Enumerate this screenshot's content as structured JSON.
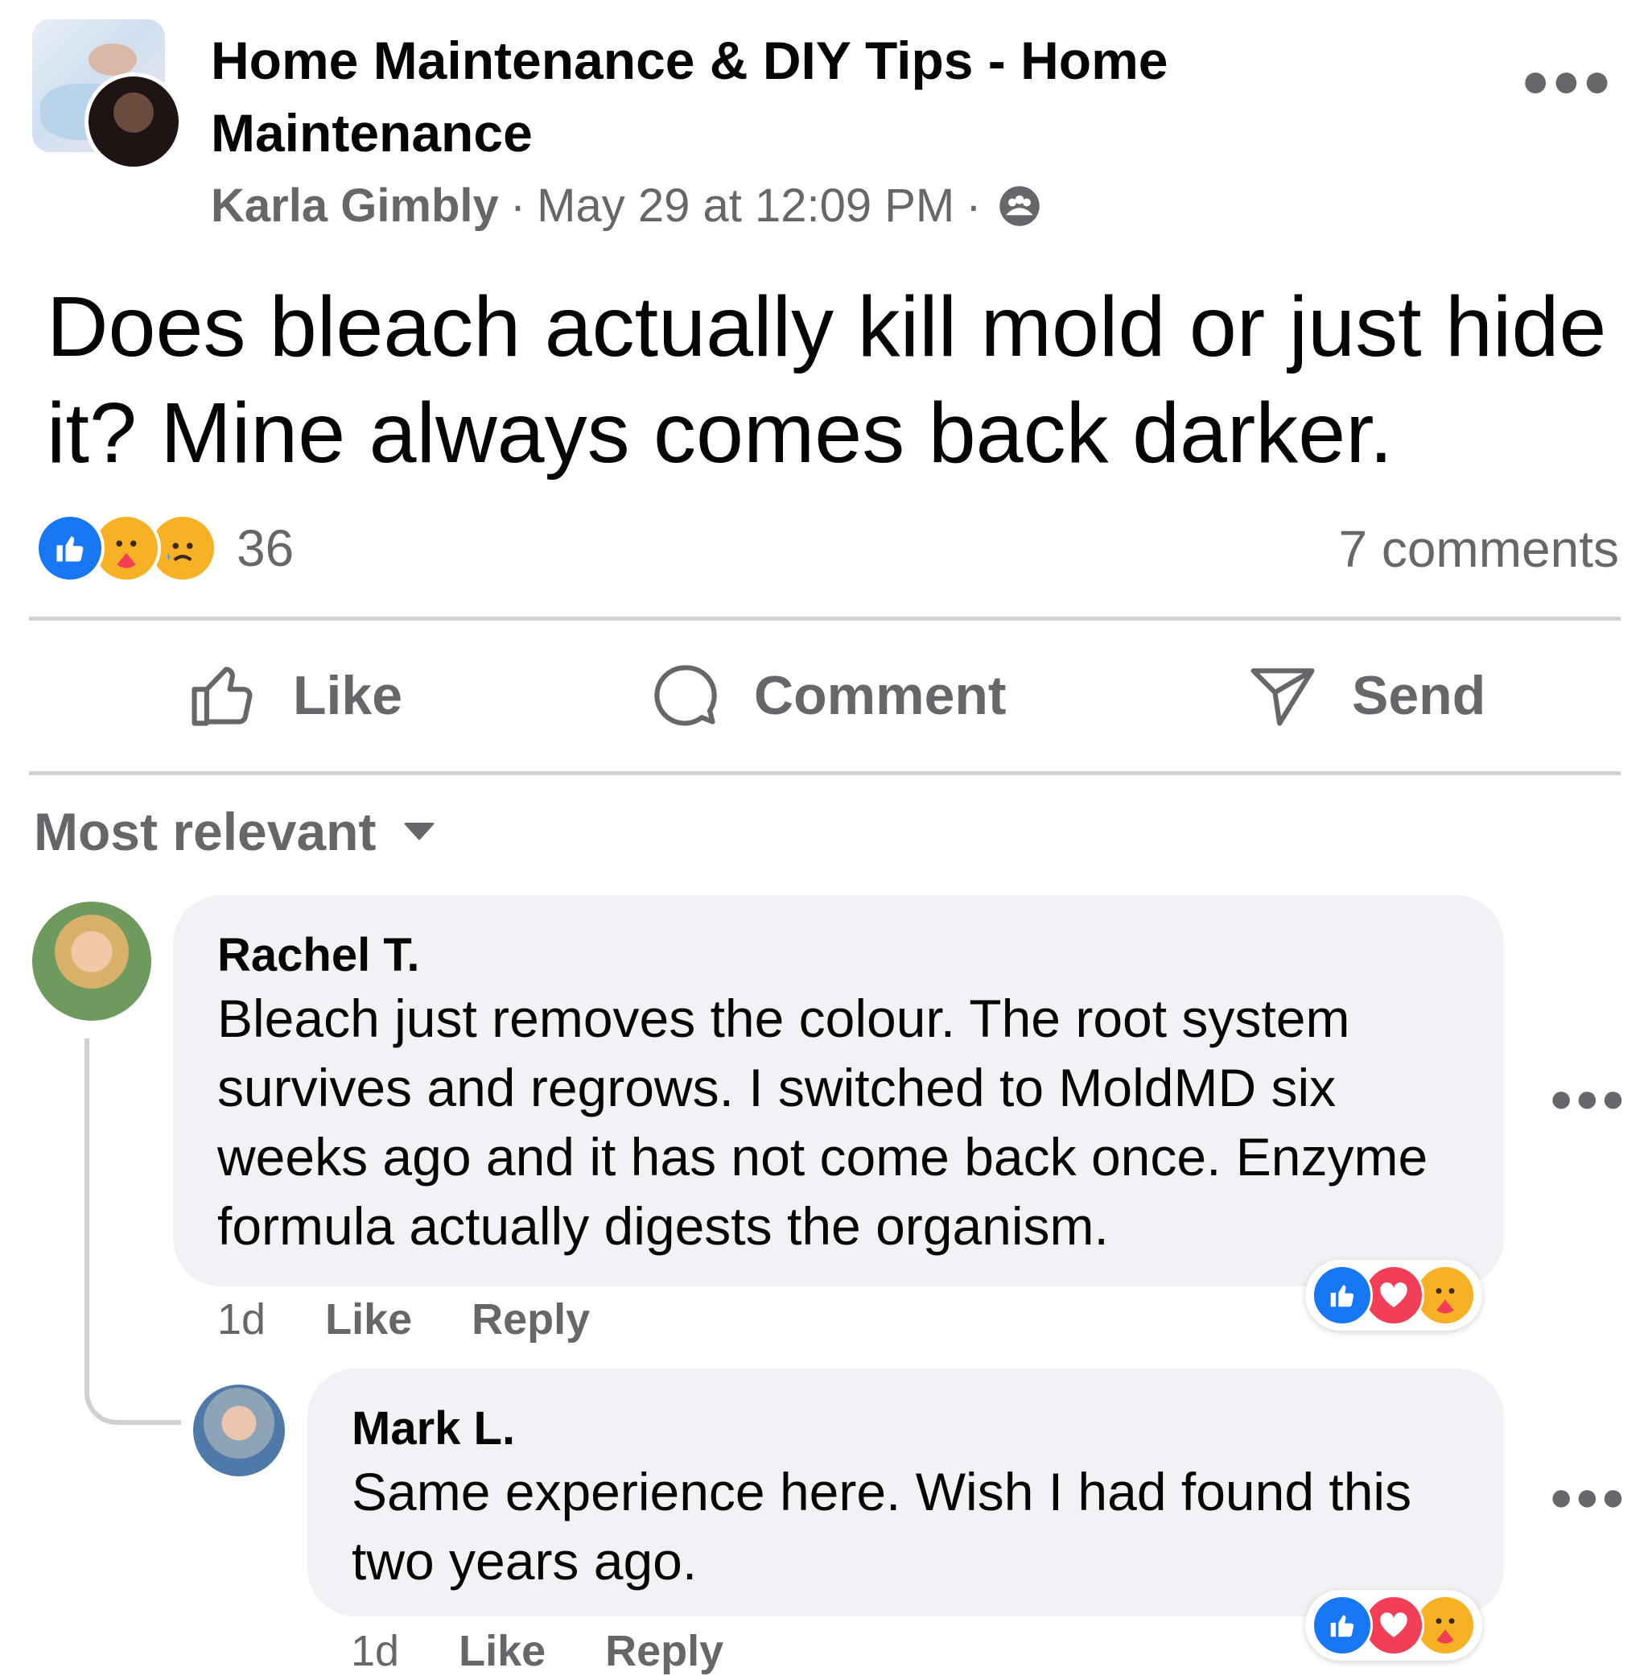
{
  "post": {
    "group_title": "Home Maintenance & DIY Tips - Home Maintenance",
    "author": "Karla Gimbly",
    "timestamp": "May 29 at 12:09 PM",
    "separator": "·",
    "privacy_icon": "group-privacy-icon",
    "more_icon": "more-options-icon",
    "text": "Does bleach actually kill mold or just hide it? Mine always comes back darker.",
    "reactions": [
      "like",
      "care",
      "sad"
    ],
    "reaction_count": "36",
    "comments_count": "7 comments"
  },
  "actions": {
    "like_label": "Like",
    "comment_label": "Comment",
    "send_label": "Send"
  },
  "sort": {
    "label": "Most relevant"
  },
  "comments": [
    {
      "name": "Rachel T.",
      "text": "Bleach just removes the colour. The root system survives and regrows. I switched to MoldMD six weeks ago and it has not come back once. Enzyme formula actually digests the organism.",
      "time": "1d",
      "like_label": "Like",
      "reply_label": "Reply",
      "reactions": [
        "like",
        "love",
        "care"
      ]
    },
    {
      "name": "Mark L.",
      "text": "Same experience here. Wish I had found this two years ago.",
      "time": "1d",
      "like_label": "Like",
      "reply_label": "Reply",
      "reactions": [
        "like",
        "love",
        "care"
      ]
    }
  ],
  "colors": {
    "accent": "#1877f2",
    "secondary_text": "#65676b",
    "bubble": "#f0f2f5",
    "love": "#f33e58",
    "care_sad": "#f7b125"
  }
}
